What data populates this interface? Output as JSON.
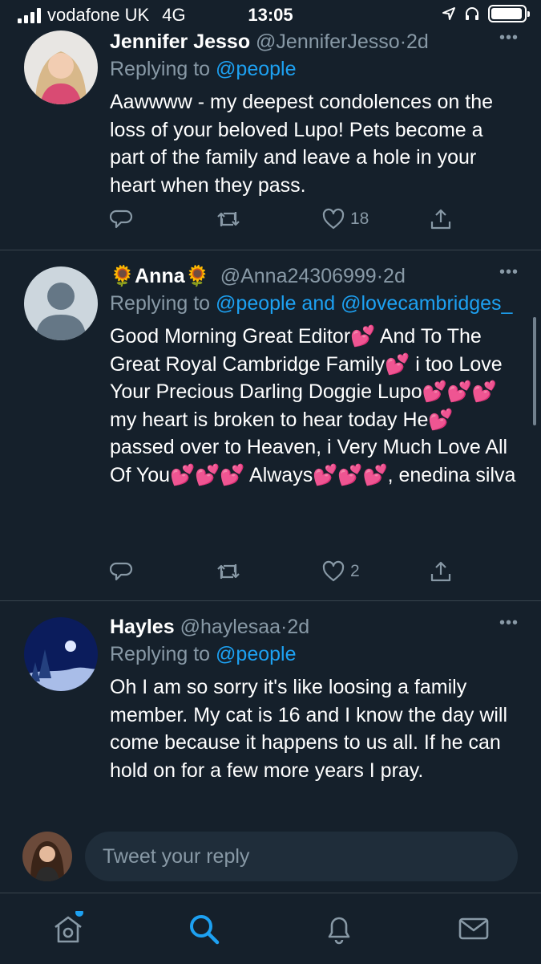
{
  "status_bar": {
    "carrier": "vodafone UK",
    "network": "4G",
    "time": "13:05",
    "battery_level": 0.95
  },
  "tweets": [
    {
      "display_name": "Jennifer Jesso",
      "handle": "@JenniferJesso",
      "separator": "·",
      "time": "2d",
      "more": "•••",
      "replying_prefix": "Replying to",
      "replying_users": "@people",
      "text": "Aawwww - my deepest condolences on the loss of your beloved Lupo! Pets become a part of the family and leave a hole in your heart when they pass.",
      "reply_count": "",
      "retweet_count": "",
      "like_count": "18"
    },
    {
      "display_name": "🌻Anna🌻",
      "handle": "@Anna24306999",
      "separator": "·",
      "time": "2d",
      "more": "•••",
      "replying_prefix": "Replying to",
      "replying_users": "@people and @lovecambridges_",
      "text": "Good Morning Great Editor💕 And To The Great Royal Cambridge Family💕 i too Love Your Precious Darling Doggie Lupo💕💕💕 my heart is broken to hear today He💕 passed over to Heaven, i Very Much Love All Of You💕💕💕 Always💕💕💕, enedina silva",
      "reply_count": "",
      "retweet_count": "",
      "like_count": "2"
    },
    {
      "display_name": "Hayles",
      "handle": "@haylesaa",
      "separator": "·",
      "time": "2d",
      "more": "•••",
      "replying_prefix": "Replying to",
      "replying_users": "@people",
      "text": "Oh I am so sorry it's like loosing a family member. My cat is 16 and I know the day will come because it happens to us all. If he can hold on for a few more years I pray.",
      "reply_count": "",
      "retweet_count": "",
      "like_count": ""
    }
  ],
  "composer": {
    "placeholder": "Tweet your reply"
  },
  "tab_bar": {
    "items": [
      "home-icon",
      "search-icon",
      "notifications-icon",
      "messages-icon"
    ],
    "active": "search-icon",
    "home_has_new": true
  },
  "colors": {
    "background": "#15202b",
    "accent": "#1da1f2",
    "secondary_text": "#8899a6",
    "divider": "#38444d"
  }
}
